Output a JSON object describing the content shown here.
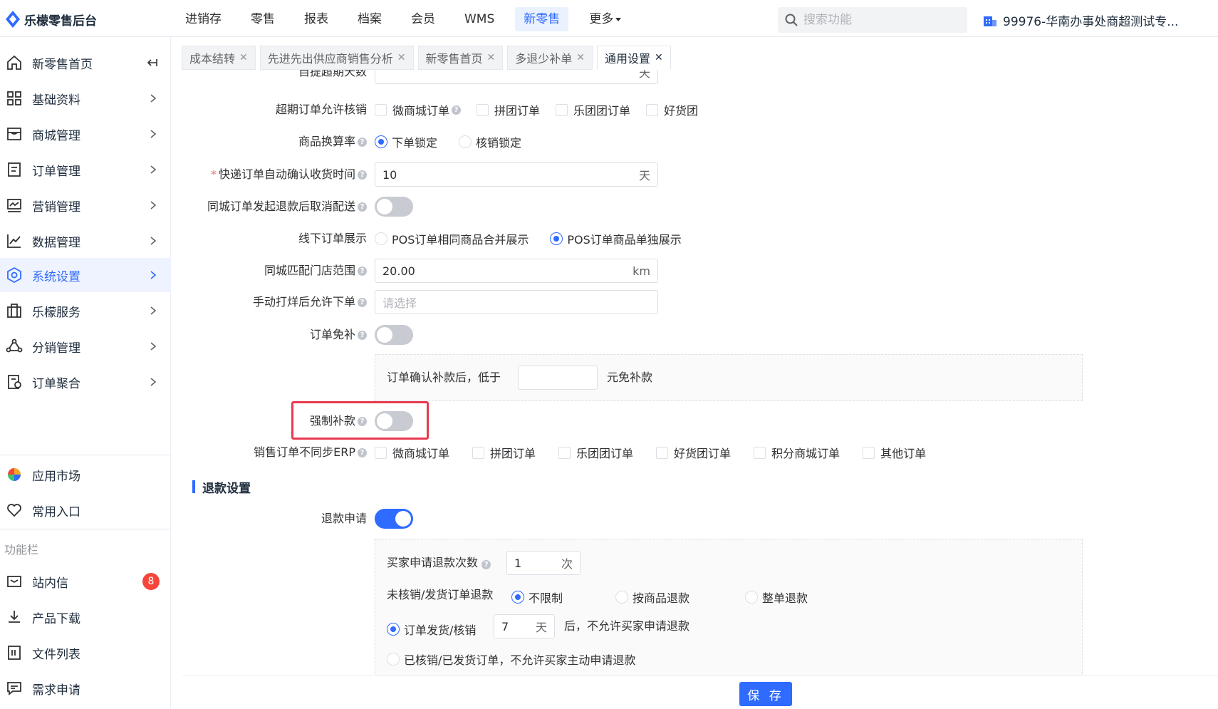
{
  "app": {
    "title": "乐檬零售后台"
  },
  "topnav": [
    {
      "label": "进销存"
    },
    {
      "label": "零售"
    },
    {
      "label": "报表"
    },
    {
      "label": "档案"
    },
    {
      "label": "会员"
    },
    {
      "label": "WMS"
    },
    {
      "label": "新零售",
      "active": true
    },
    {
      "label": "更多"
    }
  ],
  "search": {
    "placeholder": "搜索功能"
  },
  "store": {
    "label": "99976-华南办事处商超测试专..."
  },
  "sidebar": {
    "items": [
      {
        "label": "新零售首页",
        "icon": "home-icon"
      },
      {
        "label": "基础资料",
        "icon": "grid-icon"
      },
      {
        "label": "商城管理",
        "icon": "store-icon"
      },
      {
        "label": "订单管理",
        "icon": "order-icon"
      },
      {
        "label": "营销管理",
        "icon": "marketing-icon"
      },
      {
        "label": "数据管理",
        "icon": "chart-icon"
      },
      {
        "label": "系统设置",
        "icon": "settings-icon",
        "active": true
      },
      {
        "label": "乐檬服务",
        "icon": "service-icon"
      },
      {
        "label": "分销管理",
        "icon": "distribution-icon"
      },
      {
        "label": "订单聚合",
        "icon": "aggregate-icon"
      }
    ],
    "extra": [
      {
        "label": "应用市场",
        "icon": "app-market-icon"
      },
      {
        "label": "常用入口",
        "icon": "heart-icon"
      }
    ],
    "section_label": "功能栏",
    "tools": [
      {
        "label": "站内信",
        "icon": "mail-icon",
        "badge": "8"
      },
      {
        "label": "产品下载",
        "icon": "download-icon"
      },
      {
        "label": "文件列表",
        "icon": "file-list-icon"
      },
      {
        "label": "需求申请",
        "icon": "request-icon"
      }
    ]
  },
  "tabs": [
    {
      "label": "成本结转"
    },
    {
      "label": "先进先出供应商销售分析"
    },
    {
      "label": "新零售首页"
    },
    {
      "label": "多退少补单"
    },
    {
      "label": "通用设置",
      "active": true
    }
  ],
  "form": {
    "self_pickup_days": {
      "label": "自提超期天数",
      "value": "",
      "suffix": "天"
    },
    "overdue_writeoff": {
      "label": "超期订单允许核销",
      "options": [
        "微商城订单",
        "拼团订单",
        "乐团团订单",
        "好货团"
      ]
    },
    "conversion": {
      "label": "商品换算率",
      "options": [
        "下单锁定",
        "核销锁定"
      ],
      "selected": "下单锁定"
    },
    "express_confirm": {
      "label": "快递订单自动确认收货时间",
      "value": "10",
      "suffix": "天"
    },
    "city_refund_cancel": {
      "label": "同城订单发起退款后取消配送",
      "on": false
    },
    "offline_display": {
      "label": "线下订单展示",
      "options": [
        "POS订单相同商品合并展示",
        "POS订单商品单独展示"
      ],
      "selected": "POS订单商品单独展示"
    },
    "city_range": {
      "label": "同城匹配门店范围",
      "value": "20.00",
      "suffix": "km"
    },
    "manual_close": {
      "label": "手动打烊后允许下单",
      "placeholder": "请选择"
    },
    "order_free_topup": {
      "label": "订单免补",
      "on": false,
      "sub_prefix": "订单确认补款后，低于",
      "sub_suffix": "元免补款",
      "sub_value": ""
    },
    "force_topup": {
      "label": "强制补款",
      "on": false
    },
    "erp_sync": {
      "label": "销售订单不同步ERP",
      "options": [
        "微商城订单",
        "拼团订单",
        "乐团团订单",
        "好货团订单",
        "积分商城订单",
        "其他订单"
      ]
    }
  },
  "refund": {
    "section_title": "退款设置",
    "apply": {
      "label": "退款申请",
      "on": true
    },
    "times": {
      "label": "买家申请退款次数",
      "value": "1",
      "suffix": "次"
    },
    "unverified": {
      "label": "未核销/发货订单退款",
      "options": [
        "不限制",
        "按商品退款",
        "整单退款"
      ],
      "selected": "不限制"
    },
    "shipped": {
      "label": "订单发货/核销",
      "value": "7",
      "suffix": "天",
      "after": "后，不允许买家申请退款"
    },
    "verified_text": "已核销/已发货订单，不允许买家主动申请退款"
  },
  "footer": {
    "save_label": "保 存"
  },
  "colors": {
    "primary": "#2f6bff",
    "highlight": "#e83a4f",
    "badge": "#f5463c"
  }
}
